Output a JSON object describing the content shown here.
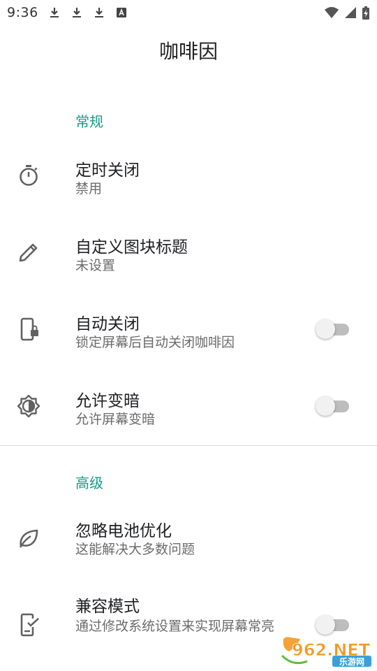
{
  "status_bar": {
    "time": "9:36",
    "icons": [
      "download-icon",
      "download-icon",
      "download-icon",
      "a-badge-icon",
      "wifi-icon",
      "signal-icon",
      "battery-charging-icon"
    ]
  },
  "app": {
    "title": "咖啡因",
    "accent_color": "#149a87"
  },
  "sections": {
    "general": {
      "header": "常规",
      "items": [
        {
          "icon": "timer-icon",
          "title": "定时关闭",
          "summary": "禁用"
        },
        {
          "icon": "pencil-icon",
          "title": "自定义图块标题",
          "summary": "未设置"
        },
        {
          "icon": "phone-lock-icon",
          "title": "自动关闭",
          "summary": "锁定屏幕后自动关闭咖啡因",
          "switch_on": false
        },
        {
          "icon": "brightness-icon",
          "title": "允许变暗",
          "summary": "允许屏幕变暗",
          "switch_on": false
        }
      ]
    },
    "advanced": {
      "header": "高级",
      "items": [
        {
          "icon": "leaf-icon",
          "title": "忽略电池优化",
          "summary": "这能解决大多数问题"
        },
        {
          "icon": "phone-check-icon",
          "title": "兼容模式",
          "summary": "通过修改系统设置来实现屏幕常亮",
          "switch_on": false
        }
      ]
    }
  },
  "watermark": {
    "brand": "962.NET",
    "sub": "乐游网"
  }
}
